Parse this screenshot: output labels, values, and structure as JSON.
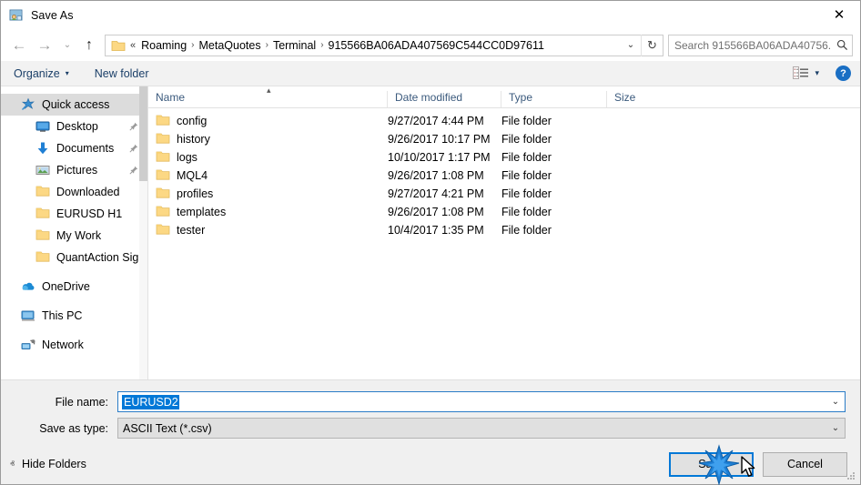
{
  "window": {
    "title": "Save As",
    "icon": "save-as-icon",
    "close_label": "✕"
  },
  "navigation": {
    "back_label": "←",
    "forward_label": "→",
    "recent_label": "⌄",
    "up_label": "↑",
    "refresh_label": "↻",
    "dropdown_label": "⌄"
  },
  "address": {
    "leading": "«",
    "crumbs": [
      "Roaming",
      "MetaQuotes",
      "Terminal",
      "915566BA06ADA407569C544CC0D97611"
    ],
    "separator": "›"
  },
  "search": {
    "placeholder": "Search 915566BA06ADA40756...",
    "icon": "search-icon"
  },
  "toolbar": {
    "organize_label": "Organize",
    "organize_caret": "▾",
    "new_folder_label": "New folder",
    "view_caret": "▾",
    "help_label": "?"
  },
  "sidebar": {
    "items": [
      {
        "label": "Quick access",
        "icon": "quick-access-star-icon",
        "selected": true,
        "indent": false,
        "pinned": false,
        "gap_before": false
      },
      {
        "label": "Desktop",
        "icon": "desktop-icon",
        "selected": false,
        "indent": true,
        "pinned": true,
        "gap_before": false
      },
      {
        "label": "Documents",
        "icon": "documents-download-icon",
        "selected": false,
        "indent": true,
        "pinned": true,
        "gap_before": false
      },
      {
        "label": "Pictures",
        "icon": "pictures-icon",
        "selected": false,
        "indent": true,
        "pinned": true,
        "gap_before": false
      },
      {
        "label": "Downloaded",
        "icon": "folder-icon",
        "selected": false,
        "indent": true,
        "pinned": false,
        "gap_before": false
      },
      {
        "label": "EURUSD H1",
        "icon": "folder-icon",
        "selected": false,
        "indent": true,
        "pinned": false,
        "gap_before": false
      },
      {
        "label": "My Work",
        "icon": "folder-icon",
        "selected": false,
        "indent": true,
        "pinned": false,
        "gap_before": false
      },
      {
        "label": "QuantAction Signal",
        "icon": "folder-icon",
        "selected": false,
        "indent": true,
        "pinned": false,
        "gap_before": false
      },
      {
        "label": "OneDrive",
        "icon": "onedrive-cloud-icon",
        "selected": false,
        "indent": false,
        "pinned": false,
        "gap_before": true
      },
      {
        "label": "This PC",
        "icon": "this-pc-icon",
        "selected": false,
        "indent": false,
        "pinned": false,
        "gap_before": true
      },
      {
        "label": "Network",
        "icon": "network-icon",
        "selected": false,
        "indent": false,
        "pinned": false,
        "gap_before": true
      }
    ],
    "pin_glyph": "📌"
  },
  "filelist": {
    "sort_indicator": "▴",
    "columns": [
      "Name",
      "Date modified",
      "Type",
      "Size"
    ],
    "rows": [
      {
        "name": "config",
        "date": "9/27/2017 4:44 PM",
        "type": "File folder",
        "size": ""
      },
      {
        "name": "history",
        "date": "9/26/2017 10:17 PM",
        "type": "File folder",
        "size": ""
      },
      {
        "name": "logs",
        "date": "10/10/2017 1:17 PM",
        "type": "File folder",
        "size": ""
      },
      {
        "name": "MQL4",
        "date": "9/26/2017 1:08 PM",
        "type": "File folder",
        "size": ""
      },
      {
        "name": "profiles",
        "date": "9/27/2017 4:21 PM",
        "type": "File folder",
        "size": ""
      },
      {
        "name": "templates",
        "date": "9/26/2017 1:08 PM",
        "type": "File folder",
        "size": ""
      },
      {
        "name": "tester",
        "date": "10/4/2017 1:35 PM",
        "type": "File folder",
        "size": ""
      }
    ]
  },
  "form": {
    "filename_label": "File name:",
    "filename_value": "EURUSD2",
    "savetype_label": "Save as type:",
    "savetype_value": "ASCII Text (*.csv)",
    "chevron": "⌄"
  },
  "actions": {
    "hide_folders_label": "Hide Folders",
    "hide_folders_caret": "ⱏ",
    "save_label": "Save",
    "cancel_label": "Cancel"
  },
  "colors": {
    "accent": "#0078d7",
    "folder": "#fcd884",
    "header_text": "#3b5a7d",
    "command_text": "#1b3f68"
  }
}
